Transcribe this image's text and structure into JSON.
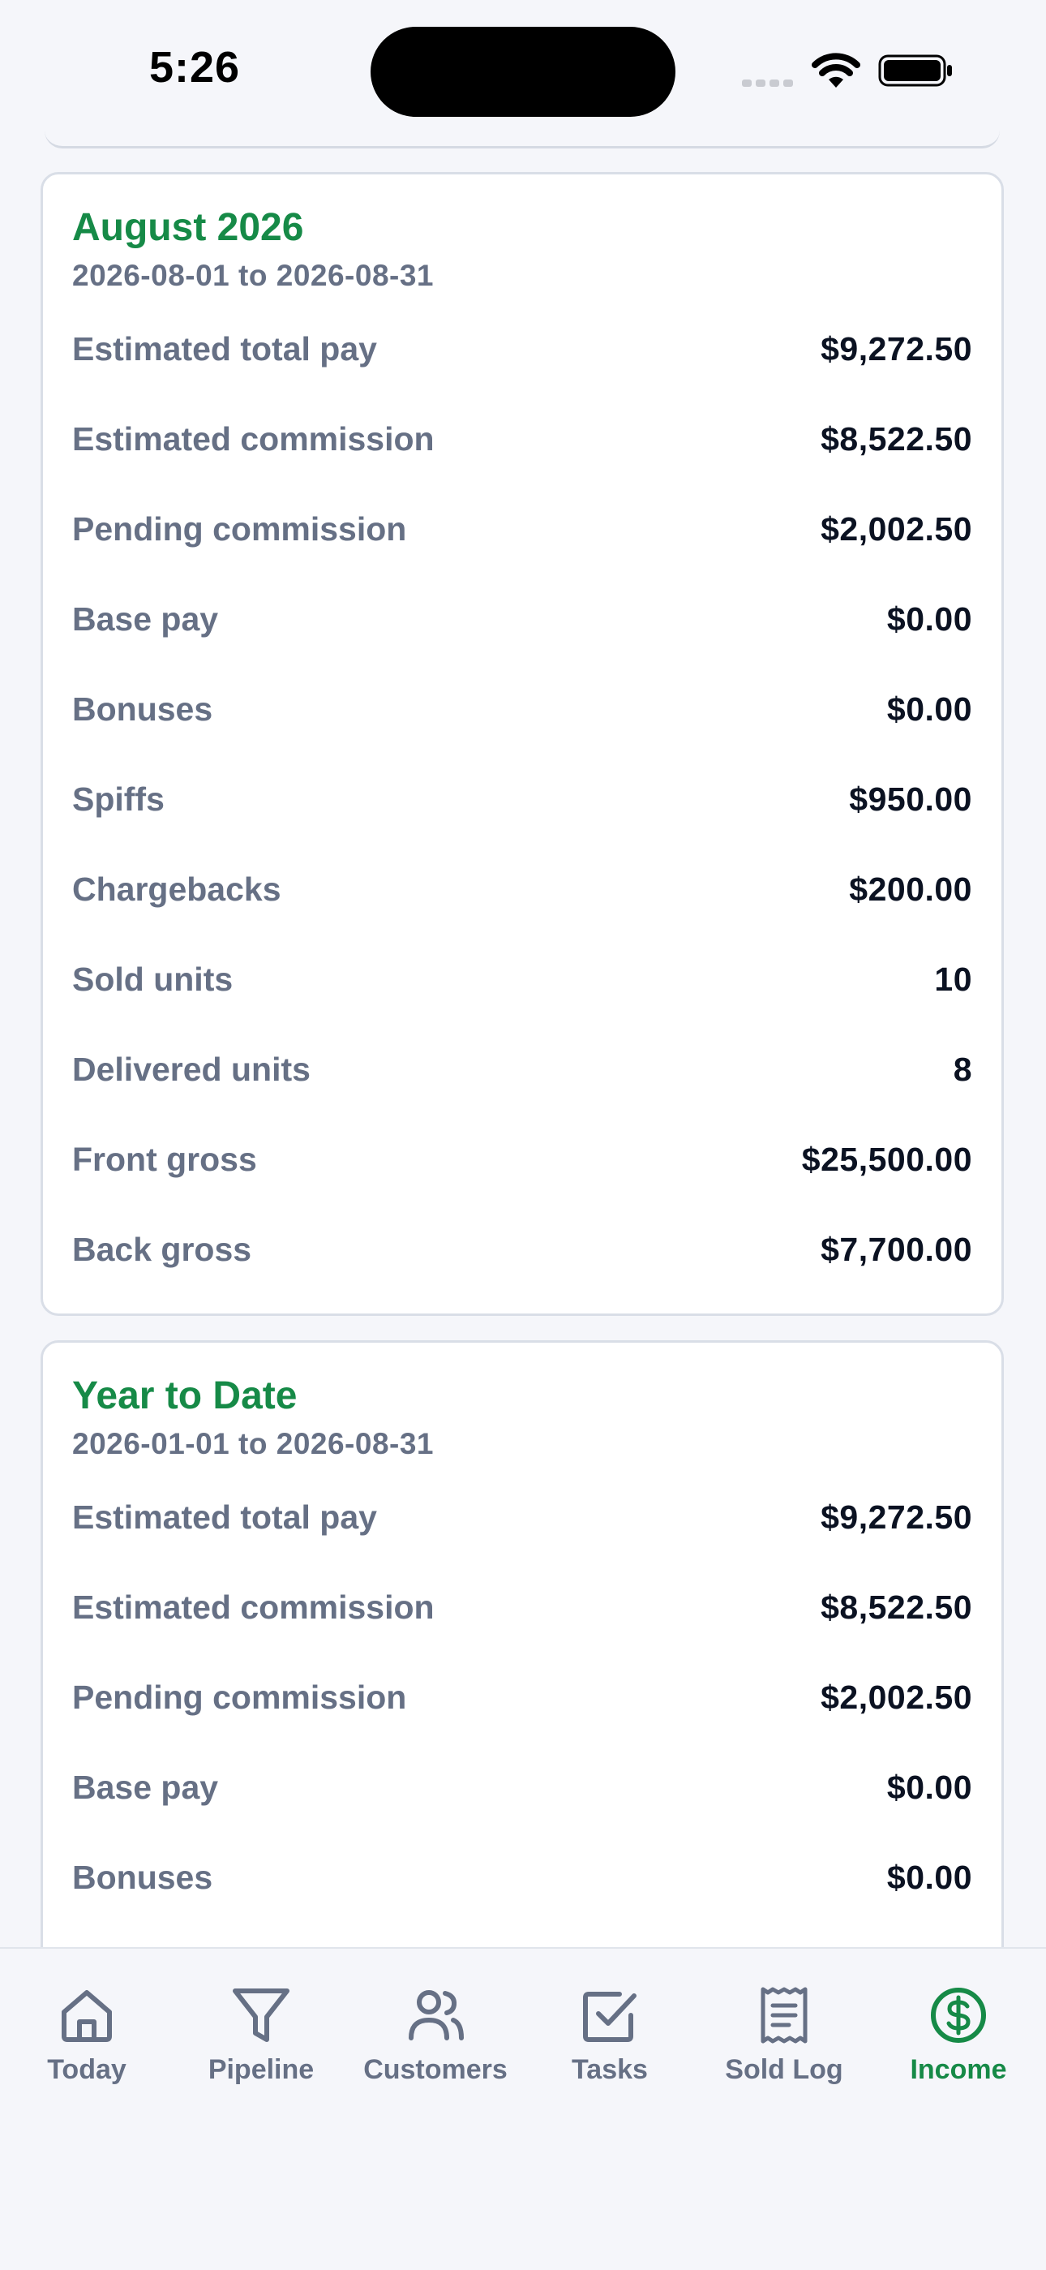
{
  "status_bar": {
    "time": "5:26"
  },
  "cards": [
    {
      "title": "August 2026",
      "range": "2026-08-01 to 2026-08-31",
      "rows": [
        {
          "label": "Estimated total pay",
          "value": "$9,272.50"
        },
        {
          "label": "Estimated commission",
          "value": "$8,522.50"
        },
        {
          "label": "Pending commission",
          "value": "$2,002.50"
        },
        {
          "label": "Base pay",
          "value": "$0.00"
        },
        {
          "label": "Bonuses",
          "value": "$0.00"
        },
        {
          "label": "Spiffs",
          "value": "$950.00"
        },
        {
          "label": "Chargebacks",
          "value": "$200.00"
        },
        {
          "label": "Sold units",
          "value": "10"
        },
        {
          "label": "Delivered units",
          "value": "8"
        },
        {
          "label": "Front gross",
          "value": "$25,500.00"
        },
        {
          "label": "Back gross",
          "value": "$7,700.00"
        }
      ]
    },
    {
      "title": "Year to Date",
      "range": "2026-01-01 to 2026-08-31",
      "rows": [
        {
          "label": "Estimated total pay",
          "value": "$9,272.50"
        },
        {
          "label": "Estimated commission",
          "value": "$8,522.50"
        },
        {
          "label": "Pending commission",
          "value": "$2,002.50"
        },
        {
          "label": "Base pay",
          "value": "$0.00"
        },
        {
          "label": "Bonuses",
          "value": "$0.00"
        }
      ]
    }
  ],
  "tabs": [
    {
      "label": "Today",
      "icon": "home-icon"
    },
    {
      "label": "Pipeline",
      "icon": "filter-icon"
    },
    {
      "label": "Customers",
      "icon": "users-icon"
    },
    {
      "label": "Tasks",
      "icon": "check-square-icon"
    },
    {
      "label": "Sold Log",
      "icon": "receipt-icon"
    },
    {
      "label": "Income",
      "icon": "dollar-circle-icon",
      "active": true
    }
  ],
  "colors": {
    "accent": "#168a47",
    "muted": "#667085",
    "value": "#0b1222",
    "background": "#f5f6fa"
  }
}
